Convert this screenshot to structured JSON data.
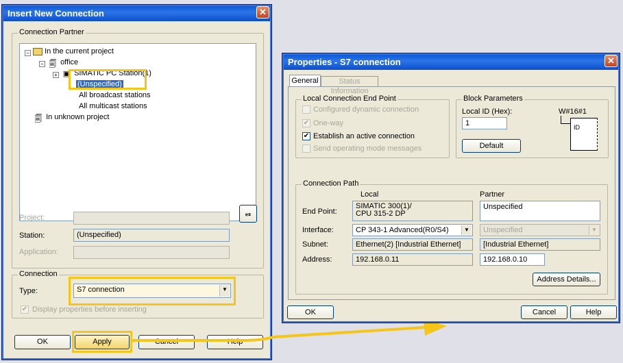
{
  "left_dialog": {
    "title": "Insert New Connection",
    "close_glyph": "✕",
    "partner_group": "Connection Partner",
    "tree": {
      "current_project": "In the current project",
      "office": "office",
      "station": "SIMATIC PC Station(1)",
      "unspecified": "(Unspecified)",
      "broadcast": "All broadcast stations",
      "multicast": "All multicast stations",
      "unknown_project": "In unknown project"
    },
    "project_label": "Project:",
    "project_value": "",
    "station_label": "Station:",
    "station_value": "(Unspecified)",
    "application_label": "Application:",
    "application_value": "",
    "connection_group": "Connection",
    "type_label": "Type:",
    "type_value": "S7 connection",
    "display_props_label": "Display properties before inserting",
    "ok": "OK",
    "apply": "Apply",
    "cancel": "Cancel",
    "help": "Help"
  },
  "right_dialog": {
    "title": "Properties - S7 connection",
    "close_glyph": "✕",
    "tabs": [
      "General",
      "Status Information"
    ],
    "local_end_group": "Local Connection End Point",
    "opt_dynamic": "Configured dynamic connection",
    "opt_oneway": "One-way",
    "opt_active": "Establish an active connection",
    "opt_sendmode": "Send operating mode messages",
    "block_group": "Block Parameters",
    "local_id_label": "Local ID (Hex):",
    "local_id_value": "1",
    "w_value": "W#16#1",
    "id_tag": "ID",
    "default_btn": "Default",
    "path_group": "Connection Path",
    "col_local": "Local",
    "col_partner": "Partner",
    "end_point_label": "End Point:",
    "end_point_local_1": "SIMATIC 300(1)/",
    "end_point_local_2": "CPU 315-2 DP",
    "end_point_partner": "Unspecified",
    "interface_label": "Interface:",
    "interface_local": "CP 343-1 Advanced(R0/S4)",
    "interface_partner": "Unspecified",
    "subnet_label": "Subnet:",
    "subnet_local": "Ethernet(2) [Industrial Ethernet]",
    "subnet_partner": "[Industrial Ethernet]",
    "address_label": "Address:",
    "address_local": "192.168.0.11",
    "address_partner": "192.168.0.10",
    "address_details_btn": "Address Details...",
    "ok": "OK",
    "cancel": "Cancel",
    "help": "Help"
  },
  "colors": {
    "highlight": "#f5c518",
    "title_blue": "#0a5bd8",
    "dialog_bg": "#ece9d8"
  }
}
